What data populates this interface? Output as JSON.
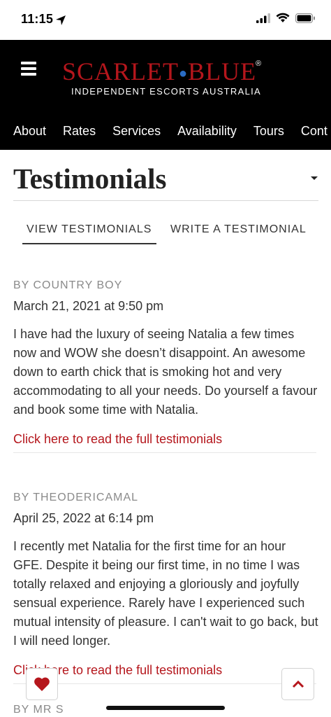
{
  "status_bar": {
    "time": "11:15"
  },
  "header": {
    "brand_left": "SCARLET",
    "brand_right": "BLUE",
    "registered": "®",
    "tagline": "INDEPENDENT ESCORTS AUSTRALIA",
    "brand_color": "#b5161c",
    "dot_color": "#2a6cc4",
    "nav": [
      {
        "label": "About"
      },
      {
        "label": "Rates"
      },
      {
        "label": "Services"
      },
      {
        "label": "Availability"
      },
      {
        "label": "Tours"
      },
      {
        "label": "Cont"
      }
    ]
  },
  "page": {
    "title": "Testimonials",
    "tabs": {
      "view": "VIEW TESTIMONIALS",
      "write": "WRITE A TESTIMONIAL",
      "active": "view"
    }
  },
  "testimonials": [
    {
      "by": "BY COUNTRY BOY",
      "date": "March 21, 2021 at 9:50 pm",
      "body": "I have had the luxury of seeing Natalia a few times now and WOW she doesn’t disappoint. An awesome down to earth chick that is smoking hot and very accommodating to all your needs. Do yourself a favour and book some time with Natalia.",
      "link": "Click here to read the full testimonials"
    },
    {
      "by": "BY THEODERICAMAL",
      "date": "April 25, 2022 at 6:14 pm",
      "body": "I recently met Natalia for the first time for an hour GFE. Despite it being our first time, in no time I was totally relaxed and enjoying a gloriously and joyfully sensual experience. Rarely have I experienced such mutual intensity of pleasure. I can't wait to go back, but I will need longer.",
      "link": "Click here to read the full testimonials"
    },
    {
      "by": "BY MR S"
    }
  ],
  "icons": {
    "favorite": "heart-icon",
    "scroll_top": "chevron-up-icon",
    "menu": "hamburger-menu-icon"
  }
}
